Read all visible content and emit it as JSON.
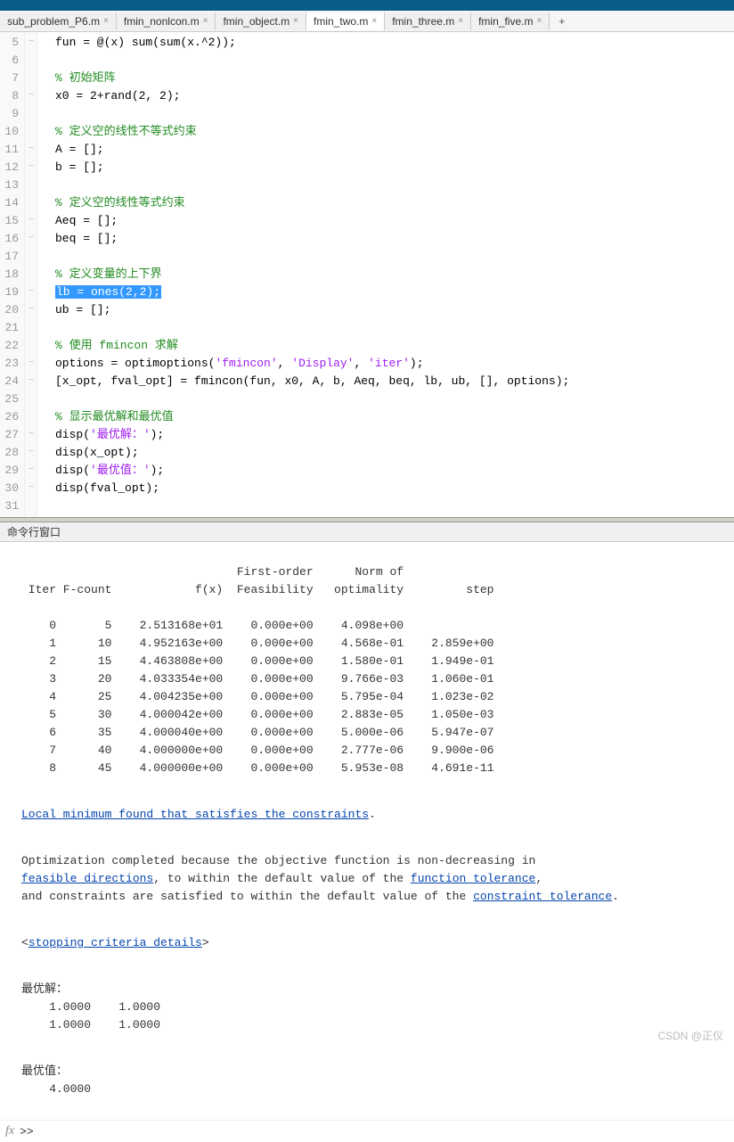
{
  "tabs": {
    "items": [
      {
        "label": "sub_problem_P6.m"
      },
      {
        "label": "fmin_nonlcon.m"
      },
      {
        "label": "fmin_object.m"
      },
      {
        "label": "fmin_two.m"
      },
      {
        "label": "fmin_three.m"
      },
      {
        "label": "fmin_five.m"
      }
    ],
    "active_index": 3,
    "add_label": "+"
  },
  "code": {
    "lines": [
      {
        "n": 5,
        "fold": "−",
        "pre": "fun = @(x) sum(sum(x.^2));"
      },
      {
        "n": 6,
        "fold": "",
        "pre": ""
      },
      {
        "n": 7,
        "fold": "",
        "comment": "% 初始矩阵"
      },
      {
        "n": 8,
        "fold": "−",
        "pre": "x0 = 2+rand(2, 2);"
      },
      {
        "n": 9,
        "fold": "",
        "pre": ""
      },
      {
        "n": 10,
        "fold": "",
        "comment": "% 定义空的线性不等式约束"
      },
      {
        "n": 11,
        "fold": "−",
        "pre": "A = [];"
      },
      {
        "n": 12,
        "fold": "−",
        "pre": "b = [];"
      },
      {
        "n": 13,
        "fold": "",
        "pre": ""
      },
      {
        "n": 14,
        "fold": "",
        "comment": "% 定义空的线性等式约束"
      },
      {
        "n": 15,
        "fold": "−",
        "pre": "Aeq = [];"
      },
      {
        "n": 16,
        "fold": "−",
        "pre": "beq = [];"
      },
      {
        "n": 17,
        "fold": "",
        "pre": ""
      },
      {
        "n": 18,
        "fold": "",
        "comment": "% 定义变量的上下界"
      },
      {
        "n": 19,
        "fold": "−",
        "selected": "lb = ones(2,2);"
      },
      {
        "n": 20,
        "fold": "−",
        "pre": "ub = [];"
      },
      {
        "n": 21,
        "fold": "",
        "pre": ""
      },
      {
        "n": 22,
        "fold": "",
        "type": "fmincon_comment",
        "c1": "% 使用 ",
        "kw": "fmincon",
        "c2": " 求解"
      },
      {
        "n": 23,
        "fold": "−",
        "type": "options",
        "p1": "options = optimoptions(",
        "s1": "'fmincon'",
        "p2": ", ",
        "s2": "'Display'",
        "p3": ", ",
        "s3": "'iter'",
        "p4": ");"
      },
      {
        "n": 24,
        "fold": "−",
        "pre": "[x_opt, fval_opt] = fmincon(fun, x0, A, b, Aeq, beq, lb, ub, [], options);"
      },
      {
        "n": 25,
        "fold": "",
        "pre": ""
      },
      {
        "n": 26,
        "fold": "",
        "comment": "% 显示最优解和最优值"
      },
      {
        "n": 27,
        "fold": "−",
        "type": "disp",
        "p1": "disp(",
        "s1": "'最优解：'",
        "p2": ");"
      },
      {
        "n": 28,
        "fold": "−",
        "pre": "disp(x_opt);"
      },
      {
        "n": 29,
        "fold": "−",
        "type": "disp",
        "p1": "disp(",
        "s1": "'最优值：'",
        "p2": ");"
      },
      {
        "n": 30,
        "fold": "−",
        "pre": "disp(fval_opt);"
      },
      {
        "n": 31,
        "fold": "",
        "pre": ""
      }
    ]
  },
  "console": {
    "header": "命令行窗口",
    "table_header": "                               First-order      Norm of\n Iter F-count            f(x)  Feasibility   optimality         step",
    "rows": [
      " 0       5    2.513168e+01    0.000e+00    4.098e+00",
      " 1      10    4.952163e+00    0.000e+00    4.568e-01    2.859e+00",
      " 2      15    4.463808e+00    0.000e+00    1.580e-01    1.949e-01",
      " 3      20    4.033354e+00    0.000e+00    9.766e-03    1.060e-01",
      " 4      25    4.004235e+00    0.000e+00    5.795e-04    1.023e-02",
      " 5      30    4.000042e+00    0.000e+00    2.883e-05    1.050e-03",
      " 6      35    4.000040e+00    0.000e+00    5.000e-06    5.947e-07",
      " 7      40    4.000000e+00    0.000e+00    2.777e-06    9.900e-06",
      " 8      45    4.000000e+00    0.000e+00    5.953e-08    4.691e-11"
    ],
    "msg1_link": "Local minimum found that satisfies the constraints",
    "msg1_tail": ".",
    "msg2_pre": "Optimization completed because the objective function is non-decreasing in ",
    "msg3_link1": "feasible directions",
    "msg3_mid": ", to within the default value of the ",
    "msg3_link2": "function tolerance",
    "msg3_tail": ",",
    "msg4_pre": "and constraints are satisfied to within the default value of the ",
    "msg4_link": "constraint tolerance",
    "msg4_tail": ".",
    "stop_pre": "<",
    "stop_link": "stopping criteria details",
    "stop_tail": ">",
    "out1_label": "最优解：",
    "out1_l1": "    1.0000    1.0000",
    "out1_l2": "    1.0000    1.0000",
    "out2_label": "最优值：",
    "out2_l1": "    4.0000",
    "prompt": ">>"
  },
  "watermark": "CSDN @正仪"
}
